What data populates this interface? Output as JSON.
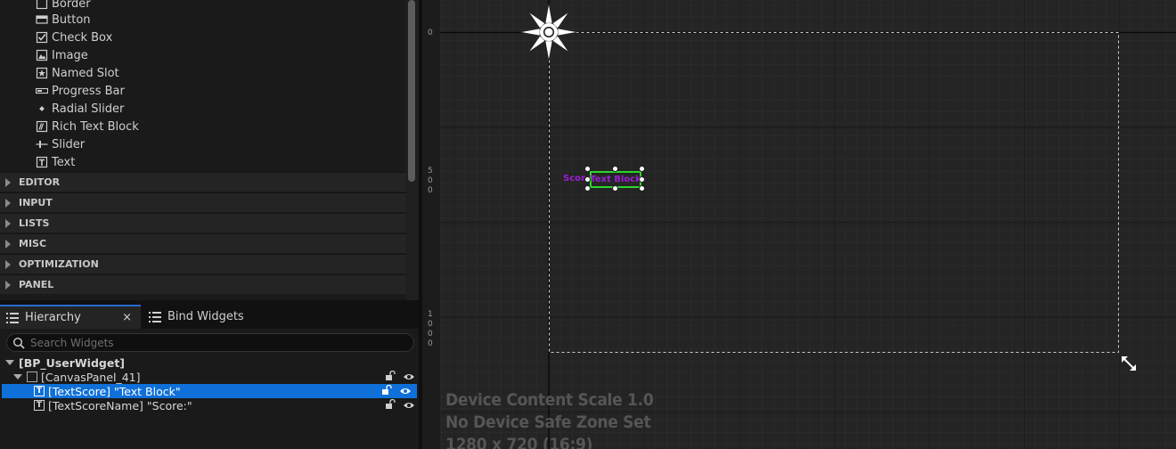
{
  "palette": {
    "items": [
      {
        "label": "Border",
        "icon": "border-icon"
      },
      {
        "label": "Button",
        "icon": "button-icon"
      },
      {
        "label": "Check Box",
        "icon": "checkbox-icon"
      },
      {
        "label": "Image",
        "icon": "image-icon"
      },
      {
        "label": "Named Slot",
        "icon": "named-slot-icon"
      },
      {
        "label": "Progress Bar",
        "icon": "progress-bar-icon"
      },
      {
        "label": "Radial Slider",
        "icon": "radial-slider-icon"
      },
      {
        "label": "Rich Text Block",
        "icon": "rich-text-icon"
      },
      {
        "label": "Slider",
        "icon": "slider-icon"
      },
      {
        "label": "Text",
        "icon": "text-icon"
      }
    ],
    "categories": [
      "EDITOR",
      "INPUT",
      "LISTS",
      "MISC",
      "OPTIMIZATION",
      "PANEL"
    ]
  },
  "hierarchy": {
    "tab_active": "Hierarchy",
    "tab_inactive": "Bind Widgets",
    "close_glyph": "×",
    "search_placeholder": "Search Widgets",
    "tree": [
      {
        "label": "[BP_UserWidget]"
      },
      {
        "label": "[CanvasPanel_41]"
      },
      {
        "label": "[TextScore] \"Text Block\"",
        "selected": true
      },
      {
        "label": "[TextScoreName] \"Score:\""
      }
    ],
    "text_icon_glyph": "T"
  },
  "designer": {
    "ruler_labels": {
      "top": "0",
      "mid": [
        "5",
        "0",
        "0"
      ],
      "bottom": [
        "1",
        "0",
        "0",
        "0"
      ]
    },
    "widgets": {
      "score_label": "Score:",
      "text_block": "Text Block"
    },
    "info": {
      "line1": "Device Content Scale 1.0",
      "line2": "No Device Safe Zone Set",
      "line3": "1280 x 720 (16:9)"
    },
    "colors": {
      "selection": "#0e70d8",
      "widget_text": "#9b1fd6",
      "widget_outline": "#2bd62b"
    }
  }
}
